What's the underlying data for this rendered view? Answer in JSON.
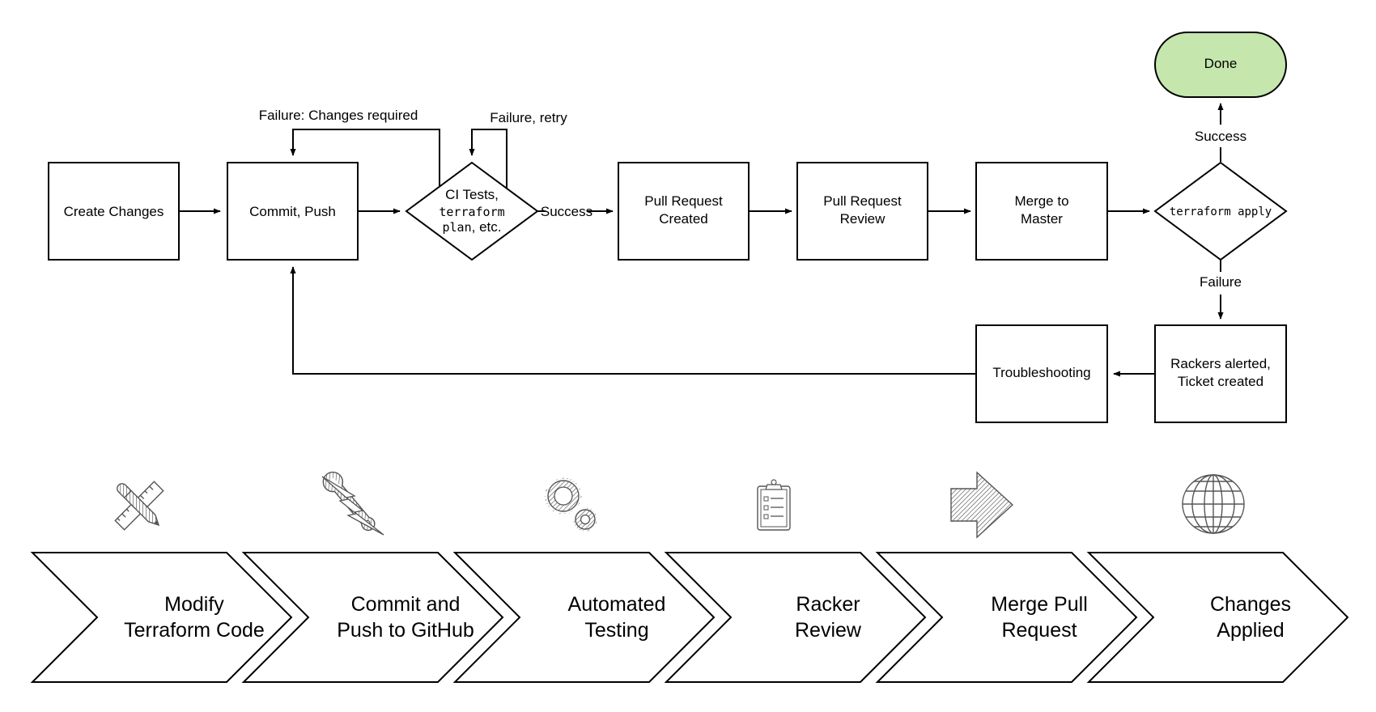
{
  "flowchart": {
    "nodes": {
      "create_changes": "Create Changes",
      "commit_push": "Commit, Push",
      "ci_tests": [
        "CI Tests,",
        "terraform",
        "plan",
        ", etc."
      ],
      "pr_created": [
        "Pull Request",
        "Created"
      ],
      "pr_review": [
        "Pull Request",
        "Review"
      ],
      "merge_master": [
        "Merge to",
        "Master"
      ],
      "terraform_apply": "terraform apply",
      "done": "Done",
      "rackers_alerted": [
        "Rackers alerted,",
        "Ticket created"
      ],
      "troubleshooting": "Troubleshooting"
    },
    "edge_labels": {
      "changes_required": "Failure: Changes required",
      "retry": "Failure, retry",
      "ci_success": "Success",
      "apply_success": "Success",
      "apply_failure": "Failure"
    },
    "colors": {
      "done_fill": "#c5e6ad",
      "stroke": "#000000",
      "icon": "#555555"
    }
  },
  "stages": [
    {
      "icon": "ruler-pencil-icon",
      "lines": [
        "Modify",
        "Terraform Code"
      ]
    },
    {
      "icon": "wrench-lightning-icon",
      "lines": [
        "Commit and",
        "Push to GitHub"
      ]
    },
    {
      "icon": "gears-icon",
      "lines": [
        "Automated",
        "Testing"
      ]
    },
    {
      "icon": "clipboard-checklist-icon",
      "lines": [
        "Racker",
        "Review"
      ]
    },
    {
      "icon": "arrow-right-icon",
      "lines": [
        "Merge Pull",
        "Request"
      ]
    },
    {
      "icon": "globe-icon",
      "lines": [
        "Changes",
        "Applied"
      ]
    }
  ]
}
